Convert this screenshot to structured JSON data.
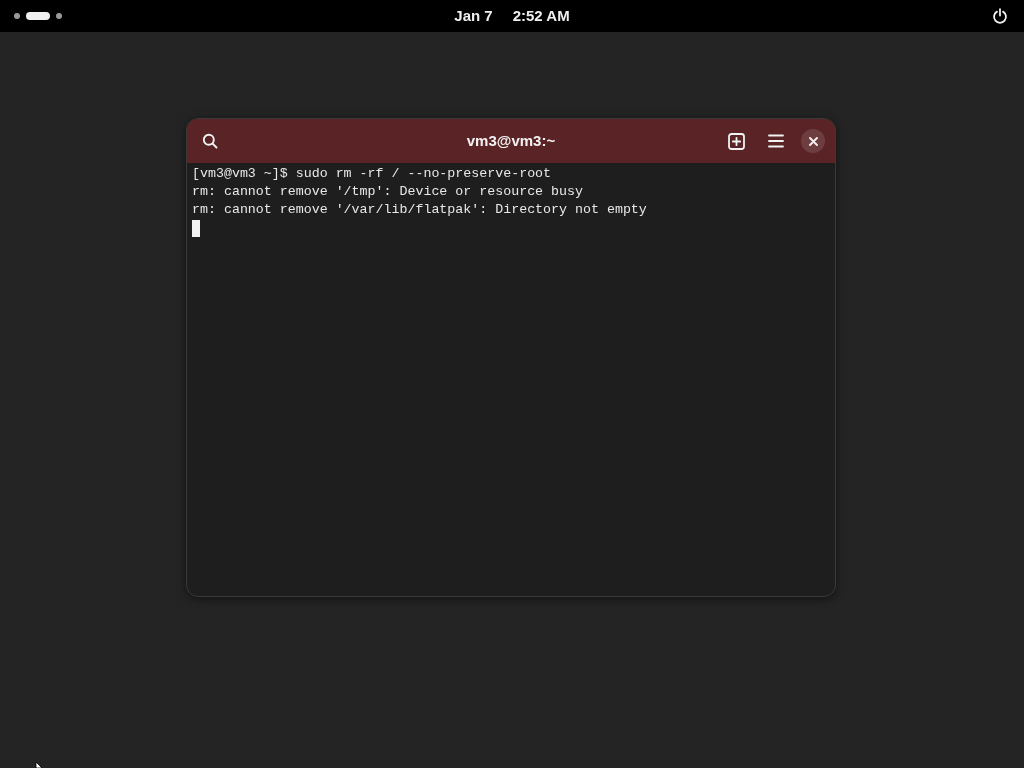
{
  "top_bar": {
    "workspaces": [
      {
        "selected": false
      },
      {
        "selected": true
      },
      {
        "selected": false
      }
    ],
    "date": "Jan 7",
    "time": "2:52 AM"
  },
  "window": {
    "title": "vm3@vm3:~"
  },
  "terminal": {
    "lines": [
      "[vm3@vm3 ~]$ sudo rm -rf / --no-preserve-root",
      "rm: cannot remove '/tmp': Device or resource busy",
      "rm: cannot remove '/var/lib/flatpak': Directory not empty"
    ],
    "cursor": true
  }
}
